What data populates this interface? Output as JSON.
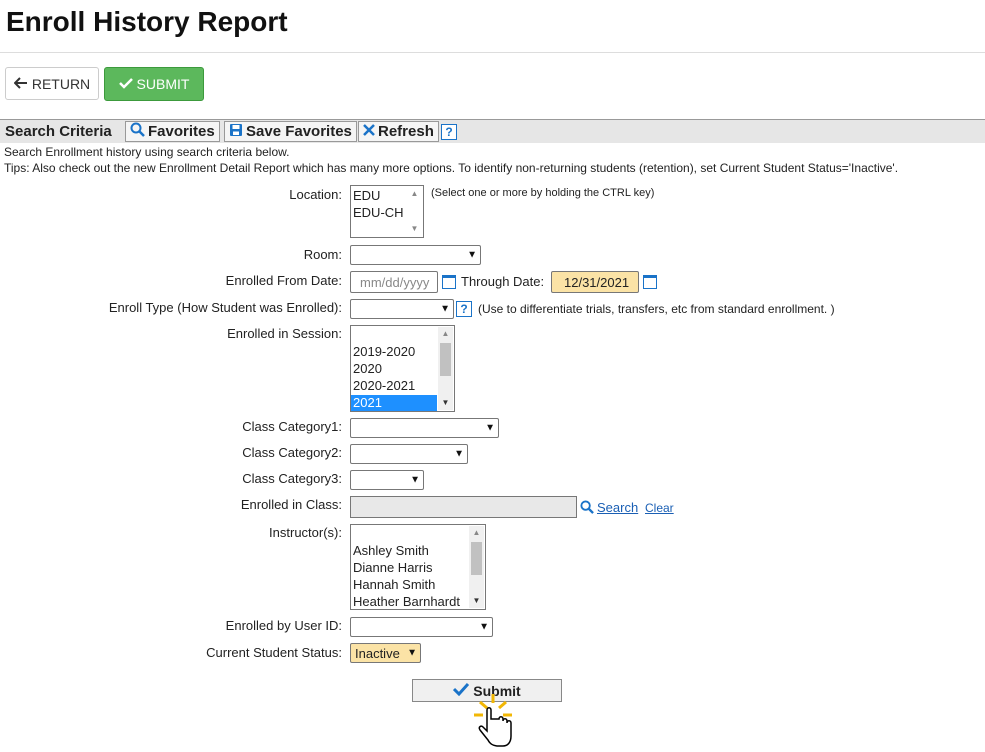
{
  "page": {
    "title": "Enroll History Report"
  },
  "actions": {
    "return_label": "RETURN",
    "submit_label": "SUBMIT"
  },
  "criteria": {
    "label": "Search Criteria",
    "favorites_label": "Favorites",
    "save_favorites_label": "Save Favorites",
    "refresh_label": "Refresh",
    "help_glyph": "?",
    "info_line": "Search Enrollment history using search criteria below.",
    "tips_line": "Tips: Also check out the new Enrollment Detail Report which has many more options. To identify non-returning students (retention), set Current Student Status='Inactive'."
  },
  "form": {
    "location": {
      "label": "Location:",
      "options": [
        "EDU",
        "EDU-CH"
      ],
      "hint": "(Select one or more by holding the CTRL key)"
    },
    "room": {
      "label": "Room:",
      "value": ""
    },
    "enrolled_from": {
      "label": "Enrolled From Date:",
      "placeholder": "mm/dd/yyyy"
    },
    "through": {
      "label": "Through Date:",
      "value": "12/31/2021"
    },
    "enroll_type": {
      "label": "Enroll Type (How Student was Enrolled):",
      "value": "",
      "hint": "(Use to differentiate trials, transfers, etc from standard enrollment. )"
    },
    "session": {
      "label": "Enrolled in Session:",
      "options": [
        "2019-2020",
        "2020",
        "2020-2021",
        "2021"
      ],
      "selected": "2021"
    },
    "cat1": {
      "label": "Class Category1:",
      "value": ""
    },
    "cat2": {
      "label": "Class Category2:",
      "value": ""
    },
    "cat3": {
      "label": "Class Category3:",
      "value": ""
    },
    "enrolled_class": {
      "label": "Enrolled in Class:",
      "search_label": "Search",
      "clear_label": "Clear"
    },
    "instructors": {
      "label": "Instructor(s):",
      "options": [
        "Ashley Smith",
        "Dianne Harris",
        "Hannah Smith",
        "Heather Barnhardt"
      ]
    },
    "user_id": {
      "label": "Enrolled by User ID:",
      "value": ""
    },
    "status": {
      "label": "Current Student Status:",
      "value": "Inactive"
    },
    "submit_label": "Submit"
  },
  "colors": {
    "accent": "#5cb85c",
    "link": "#1a5fb4",
    "highlight": "#fbe3a6",
    "selected": "#1e90ff"
  }
}
